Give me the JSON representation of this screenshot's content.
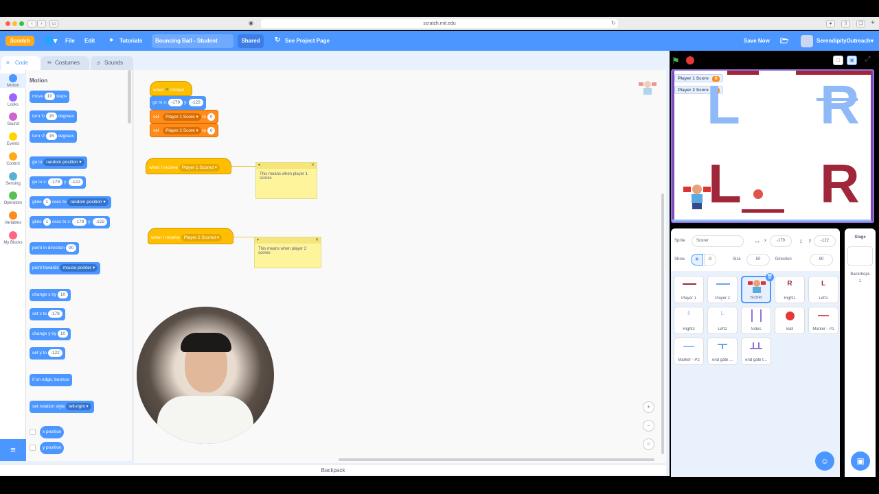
{
  "browser": {
    "url": "scratch.mit.edu"
  },
  "menu": {
    "logo": "Scratch",
    "file": "File",
    "edit": "Edit",
    "tutorials": "Tutorials",
    "project_title": "Bouncing Ball - Student",
    "shared": "Shared",
    "see_project_page": "See Project Page",
    "save_now": "Save Now",
    "username": "SerendipityOutreach"
  },
  "tabs": {
    "code": "Code",
    "costumes": "Costumes",
    "sounds": "Sounds"
  },
  "categories": [
    {
      "label": "Motion",
      "color": "#4c97ff"
    },
    {
      "label": "Looks",
      "color": "#9966ff"
    },
    {
      "label": "Sound",
      "color": "#cf63cf"
    },
    {
      "label": "Events",
      "color": "#ffd500"
    },
    {
      "label": "Control",
      "color": "#ffab19"
    },
    {
      "label": "Sensing",
      "color": "#5cb1d6"
    },
    {
      "label": "Operators",
      "color": "#59c059"
    },
    {
      "label": "Variables",
      "color": "#ff8c1a"
    },
    {
      "label": "My Blocks",
      "color": "#ff6680"
    }
  ],
  "palette": {
    "heading": "Motion",
    "move": "move",
    "move_val": "10",
    "steps": "steps",
    "turn": "turn",
    "turn_val": "15",
    "degrees": "degrees",
    "goto": "go to",
    "random_position": "random position",
    "goto_xy": "go to x:",
    "x_val": "-179",
    "y_lbl": "y:",
    "y_val": "-122",
    "glide": "glide",
    "glide_val": "1",
    "secs_to": "secs to",
    "secs_to_x": "secs to x:",
    "point_dir": "point in direction",
    "dir_val": "90",
    "point_towards": "point towards",
    "mouse_pointer": "mouse-pointer",
    "change_x": "change x by",
    "change_x_val": "10",
    "set_x": "set x to",
    "set_x_val": "-179",
    "change_y": "change y by",
    "change_y_val": "10",
    "set_y": "set y to",
    "set_y_val": "-122",
    "bounce": "if on edge, bounce",
    "rot_style": "set rotation style",
    "left_right": "left-right",
    "x_position": "x position",
    "y_position": "y position"
  },
  "script1": {
    "when": "when",
    "clicked": "clicked",
    "goto": "go to x:",
    "x": "-179",
    "y_lbl": "y:",
    "y": "-122",
    "set": "set",
    "var1": "Player 1 Score",
    "to": "to",
    "v1": "0",
    "var2": "Player 2 Score",
    "v2": "0"
  },
  "script2": {
    "when_receive": "when I receive",
    "msg": "Player 1 Scored",
    "note": "This means when player 1 scores"
  },
  "script3": {
    "when_receive": "when I receive",
    "msg": "Player 2 Scored",
    "note": "This means when player 2 scores"
  },
  "backpack": "Backpack",
  "stage": {
    "monitor1_label": "Player 1 Score",
    "monitor1_value": "0",
    "monitor2_label": "Player 2 Score",
    "monitor2_value": "0",
    "letter_L": "L",
    "letter_R": "R"
  },
  "sprite_info": {
    "sprite_lbl": "Sprite",
    "name": "Scorer",
    "x_lbl": "x",
    "x": "-179",
    "y_lbl": "y",
    "y": "-122",
    "show_lbl": "Show",
    "size_lbl": "Size",
    "size": "50",
    "direction_lbl": "Direction",
    "direction": "90"
  },
  "sprites": [
    "Player 1",
    "Player 2",
    "Scorer",
    "Right1",
    "Left1",
    "Right3",
    "Left2",
    "Sides",
    "Ball",
    "Marker - P1",
    "Marker - P2",
    "end gate ...",
    "end gate t..."
  ],
  "stage_panel": {
    "title": "Stage",
    "backdrops_lbl": "Backdrops",
    "backdrops": "1"
  }
}
